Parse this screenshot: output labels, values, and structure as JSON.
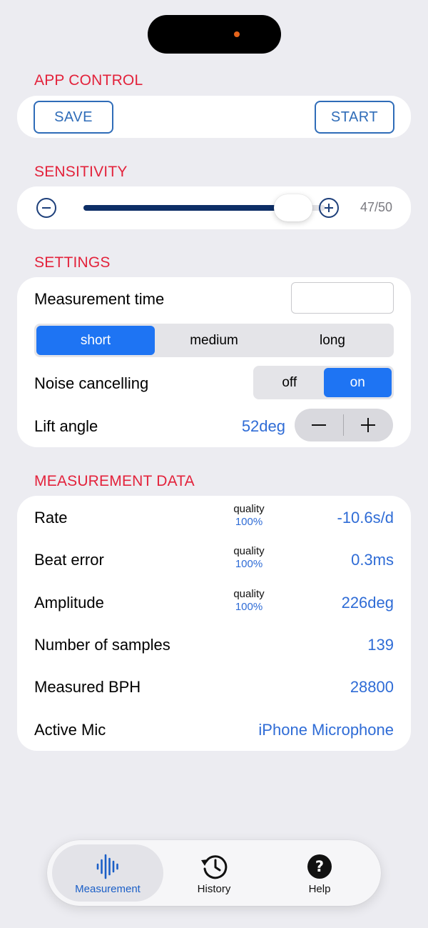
{
  "sections": {
    "app_control": "APP CONTROL",
    "sensitivity": "SENSITIVITY",
    "settings": "SETTINGS",
    "measurement_data": "MEASUREMENT DATA"
  },
  "app_control": {
    "save_label": "SAVE",
    "start_label": "START"
  },
  "sensitivity": {
    "value": 47,
    "max": 50,
    "display": "47/50"
  },
  "settings": {
    "measurement_time": {
      "label": "Measurement time",
      "value": "",
      "options": [
        "short",
        "medium",
        "long"
      ],
      "selected": "short"
    },
    "noise_cancelling": {
      "label": "Noise cancelling",
      "options": [
        "off",
        "on"
      ],
      "selected": "on"
    },
    "lift_angle": {
      "label": "Lift angle",
      "value": "52deg"
    }
  },
  "measurement_data": {
    "quality_label": "quality",
    "rows": [
      {
        "label": "Rate",
        "quality": "100%",
        "value": "-10.6s/d"
      },
      {
        "label": "Beat error",
        "quality": "100%",
        "value": "0.3ms"
      },
      {
        "label": "Amplitude",
        "quality": "100%",
        "value": "226deg"
      },
      {
        "label": "Number of samples",
        "value": "139"
      },
      {
        "label": "Measured BPH",
        "value": "28800"
      },
      {
        "label": "Active Mic",
        "value": "iPhone Microphone"
      }
    ]
  },
  "tabs": [
    {
      "label": "Measurement",
      "icon": "waveform-icon",
      "active": true
    },
    {
      "label": "History",
      "icon": "clock-history-icon",
      "active": false
    },
    {
      "label": "Help",
      "icon": "question-circle-icon",
      "active": false
    }
  ],
  "colors": {
    "section_header": "#e3223b",
    "accent_blue": "#2f6cd6",
    "segment_selected": "#1e74f3",
    "slider_fill": "#0d2e66",
    "background": "#ececf1"
  }
}
